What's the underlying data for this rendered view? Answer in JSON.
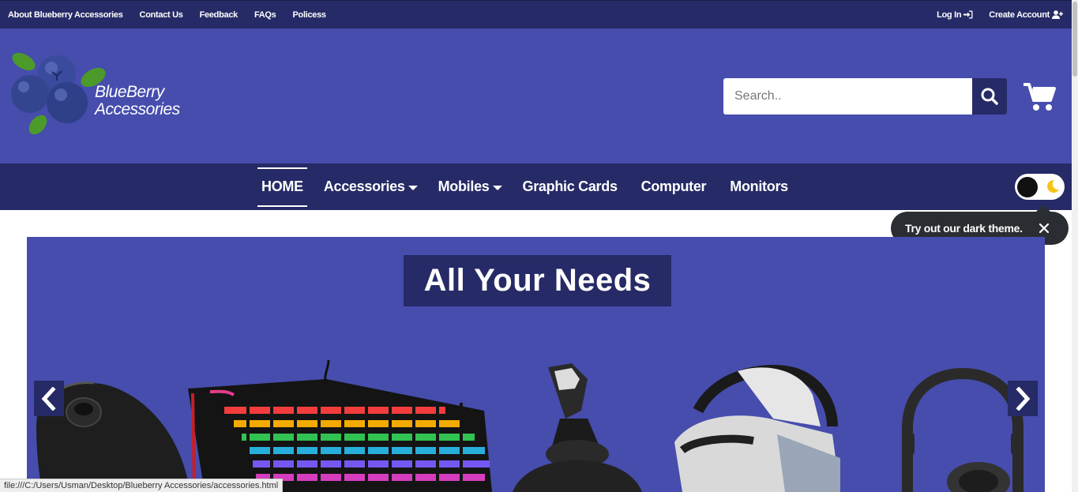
{
  "topbar": {
    "links": [
      {
        "label": "About Blueberry Accessories"
      },
      {
        "label": "Contact Us"
      },
      {
        "label": "Feedback"
      },
      {
        "label": "FAQs"
      },
      {
        "label": "Policess"
      }
    ],
    "login": {
      "label": "Log In",
      "icon": "sign-in-icon"
    },
    "create_account": {
      "label": "Create Account",
      "icon": "user-plus-icon"
    }
  },
  "header": {
    "brand_line1": "BlueBerry",
    "brand_line2": "Accessories",
    "logo_icon": "blueberry-logo",
    "search": {
      "placeholder": "Search..",
      "value": "",
      "icon": "search-icon"
    },
    "cart_icon": "cart-icon"
  },
  "nav": {
    "items": [
      {
        "label": "HOME",
        "active": true
      },
      {
        "label": "Accessories",
        "dropdown": true
      },
      {
        "label": "Mobiles",
        "dropdown": true
      },
      {
        "label": "Graphic Cards"
      },
      {
        "label": "Computer"
      },
      {
        "label": "Monitors"
      }
    ]
  },
  "theme_toggle": {
    "state": "light",
    "icon": "moon-icon"
  },
  "tooltip": {
    "text": "Try out our dark theme.",
    "close_icon": "close-icon"
  },
  "banner": {
    "title": "All Your Needs",
    "prev_icon": "chevron-left-icon",
    "next_icon": "chevron-right-icon",
    "products": [
      "mouse",
      "rgb-keyboard",
      "joystick",
      "vr-headset",
      "headphones"
    ]
  },
  "statusbar": {
    "url": "file:///C:/Users/Usman/Desktop/Blueberry Accessories/accessories.html"
  },
  "colors": {
    "dark_navy": "#262a66",
    "primary": "#464dad",
    "moon": "#f5c518",
    "tooltip_bg": "#2a2e33"
  }
}
